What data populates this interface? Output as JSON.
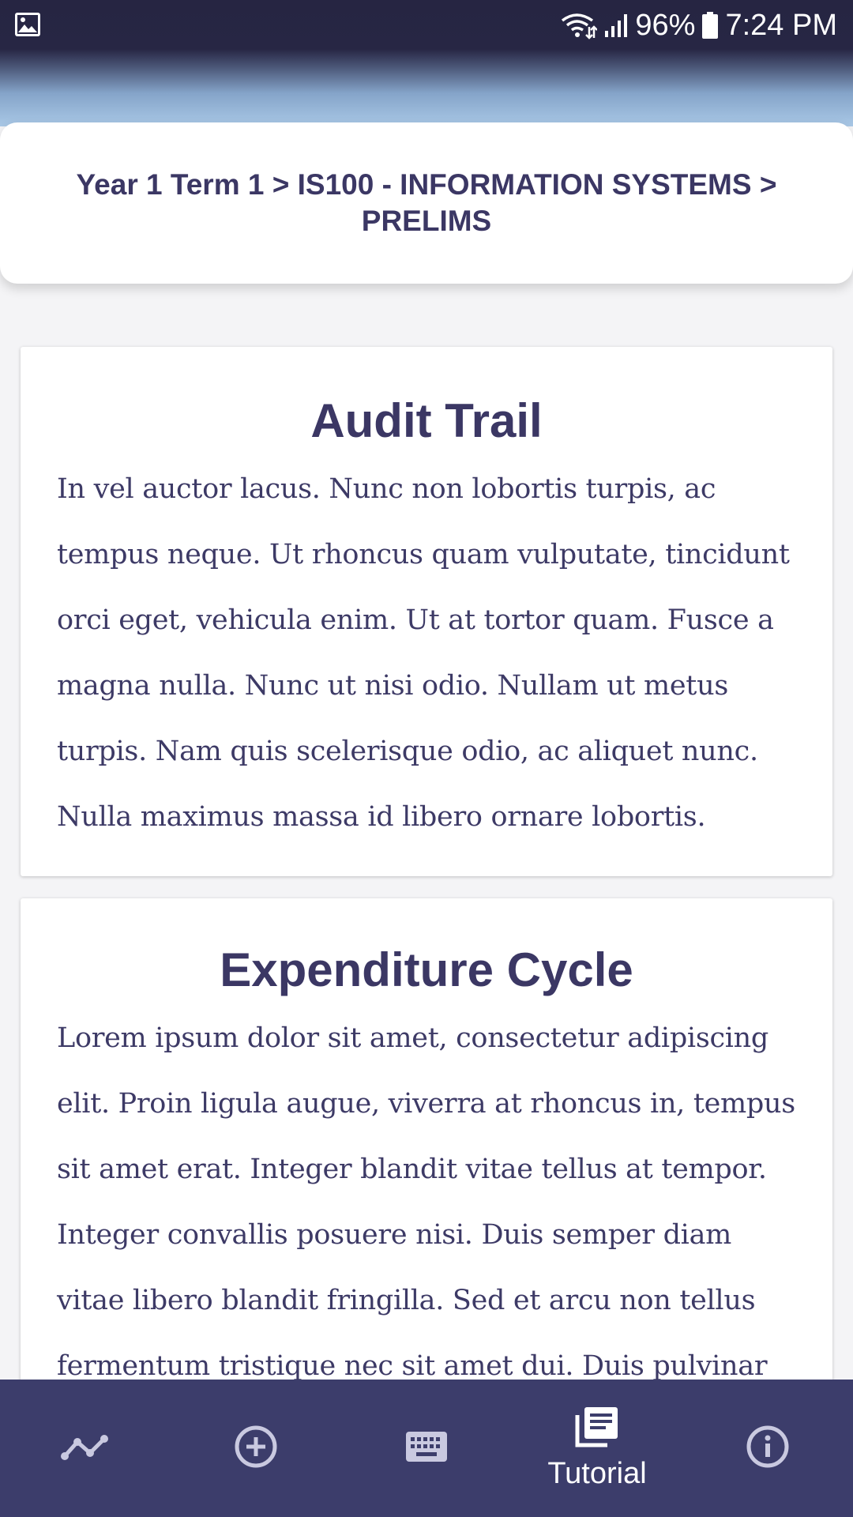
{
  "status_bar": {
    "battery_percent": "96%",
    "time": "7:24 PM",
    "icons": [
      "gallery-icon",
      "wifi-icon",
      "signal-icon",
      "battery-icon"
    ]
  },
  "breadcrumb": {
    "text": "Year 1 Term 1 > IS100 - INFORMATION SYSTEMS > PRELIMS"
  },
  "topics": [
    {
      "title": "Audit Trail",
      "body": "In vel auctor lacus. Nunc non lobortis turpis, ac tempus neque. Ut rhoncus quam vulputate, tincidunt orci eget, vehicula enim. Ut at tortor quam. Fusce a magna nulla. Nunc ut nisi odio. Nullam ut metus turpis. Nam quis scelerisque odio, ac aliquet nunc. Nulla maximus massa id libero ornare lobortis."
    },
    {
      "title": "Expenditure Cycle",
      "body": "Lorem ipsum dolor sit amet, consectetur adipiscing elit. Proin ligula augue, viverra at rhoncus in, tempus sit amet erat. Integer blandit vitae tellus at tempor. Integer convallis posuere nisi. Duis semper diam vitae libero blandit fringilla. Sed et arcu non tellus fermentum tristique nec sit amet dui. Duis pulvinar"
    }
  ],
  "bottom_nav": {
    "items": [
      {
        "icon": "trend-line-icon",
        "label": ""
      },
      {
        "icon": "add-circle-icon",
        "label": ""
      },
      {
        "icon": "keyboard-icon",
        "label": ""
      },
      {
        "icon": "library-books-icon",
        "label": "Tutorial",
        "active": true
      },
      {
        "icon": "info-icon",
        "label": ""
      }
    ]
  },
  "colors": {
    "header_dark": "#262542",
    "text_primary": "#3b3764",
    "nav_background": "#3c3d6b",
    "page_background": "#f4f4f6"
  }
}
